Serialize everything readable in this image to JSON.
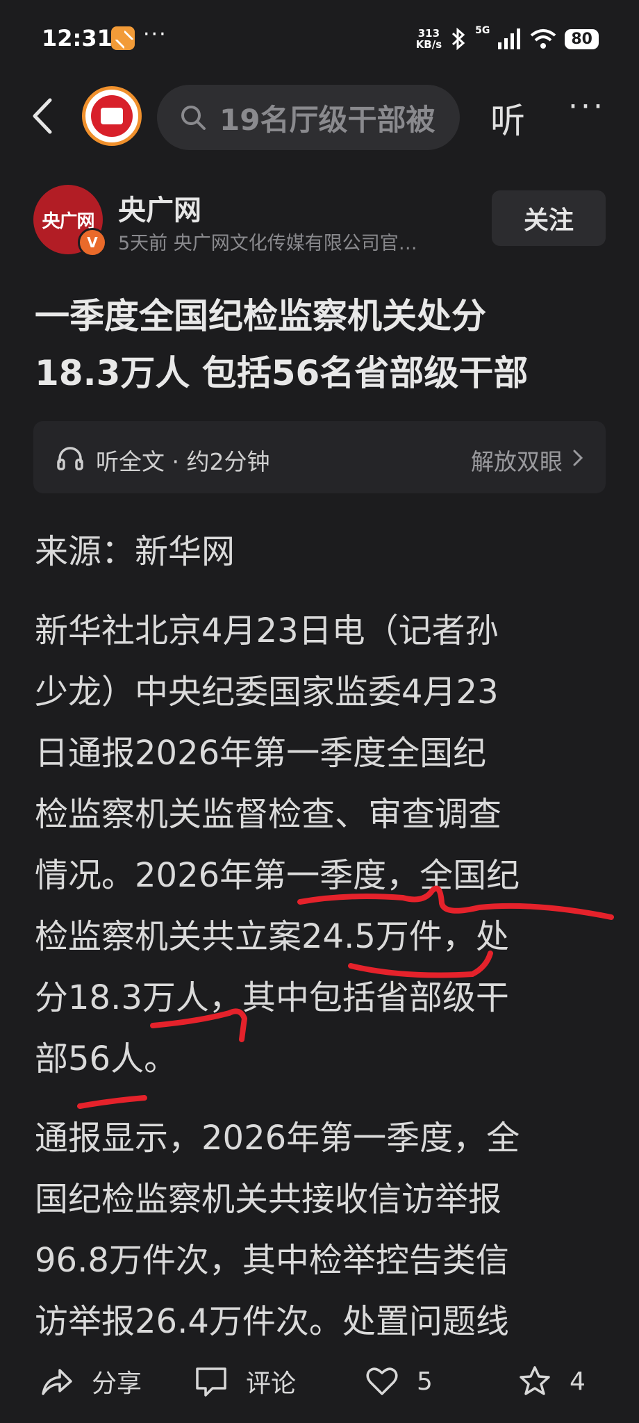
{
  "status_bar": {
    "time": "12:31",
    "app_icon": "notification-app-icon",
    "dots": "···",
    "net_speed_value": "313",
    "net_speed_unit": "KB/s",
    "network": "5G",
    "battery": "80"
  },
  "top_nav": {
    "search_text": "19名厅级干部被",
    "listen_label": "听",
    "more_label": "···"
  },
  "author": {
    "logo_text": "央广网",
    "verified_mark": "V",
    "name": "央广网",
    "meta": "5天前   央广网文化传媒有限公司官…",
    "follow_label": "关注"
  },
  "headline": {
    "line1": "一季度全国纪检监察机关处分",
    "line2": "18.3万人 包括56名省部级干部"
  },
  "listen_bar": {
    "label": "听全文 · 约2分钟",
    "right": "解放双眼"
  },
  "article": {
    "source": "来源：新华网",
    "para1": [
      "新华社北京4月23日电（记者孙",
      "少龙）中央纪委国家监委4月23",
      "日通报2026年第一季度全国纪",
      "检监察机关监督检查、审查调查",
      "情况。2026年第一季度，全国纪",
      "检监察机关共立案24.5万件，处",
      "分18.3万人，其中包括省部级干",
      "部56人。"
    ],
    "para2": [
      "通报显示，2026年第一季度，全",
      "国纪检监察机关共接收信访举报",
      "96.8万件次，其中检举控告类信",
      "访举报26.4万件次。处置问题线"
    ]
  },
  "bottom_bar": {
    "share_label": "分享",
    "comment_label": "评论",
    "like_count": "5",
    "favorite_count": "4"
  },
  "colors": {
    "background": "#1c1c1e",
    "annotation_red": "#e5222b",
    "accent_orange": "#f0902c",
    "brand_red": "#b21d25"
  }
}
